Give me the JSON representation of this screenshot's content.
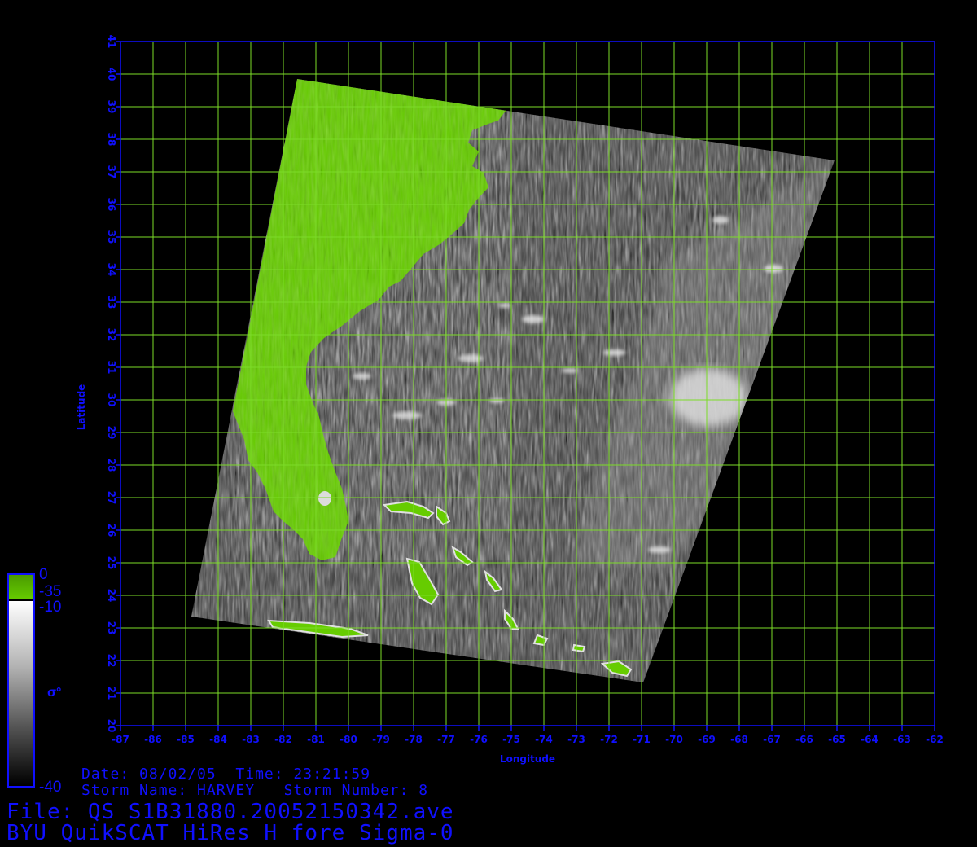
{
  "map": {
    "lon_range": [
      -87,
      -62
    ],
    "lat_range": [
      20,
      41
    ],
    "lon_ticks": [
      "-87",
      "-86",
      "-85",
      "-84",
      "-83",
      "-82",
      "-81",
      "-80",
      "-79",
      "-78",
      "-77",
      "-76",
      "-75",
      "-74",
      "-73",
      "-72",
      "-71",
      "-70",
      "-69",
      "-68",
      "-67",
      "-66",
      "-65",
      "-64",
      "-63",
      "-62"
    ],
    "lat_ticks": [
      "20",
      "21",
      "22",
      "23",
      "24",
      "25",
      "26",
      "27",
      "28",
      "29",
      "30",
      "31",
      "32",
      "33",
      "34",
      "35",
      "36",
      "37",
      "38",
      "39",
      "40",
      "41"
    ],
    "xlabel": "Longitude",
    "ylabel": "Latitude",
    "grid": true,
    "colors": {
      "axis": "#1010ff",
      "grid": "#7cdc28",
      "land": "#66cc00",
      "background": "#000000"
    }
  },
  "colorbar": {
    "land_top": "0",
    "land_bottom": "-35",
    "sigma_top": "-10",
    "sigma_bottom": "-40",
    "symbol": "σ°"
  },
  "info": {
    "line1": "Date: 08/02/05  Time: 23:21:59",
    "line2": "Storm Name: HARVEY   Storm Number: 8",
    "line3": "File: QS_S1B31880.20052150342.ave",
    "line4": "BYU QuikSCAT HiRes H fore Sigma-0"
  }
}
